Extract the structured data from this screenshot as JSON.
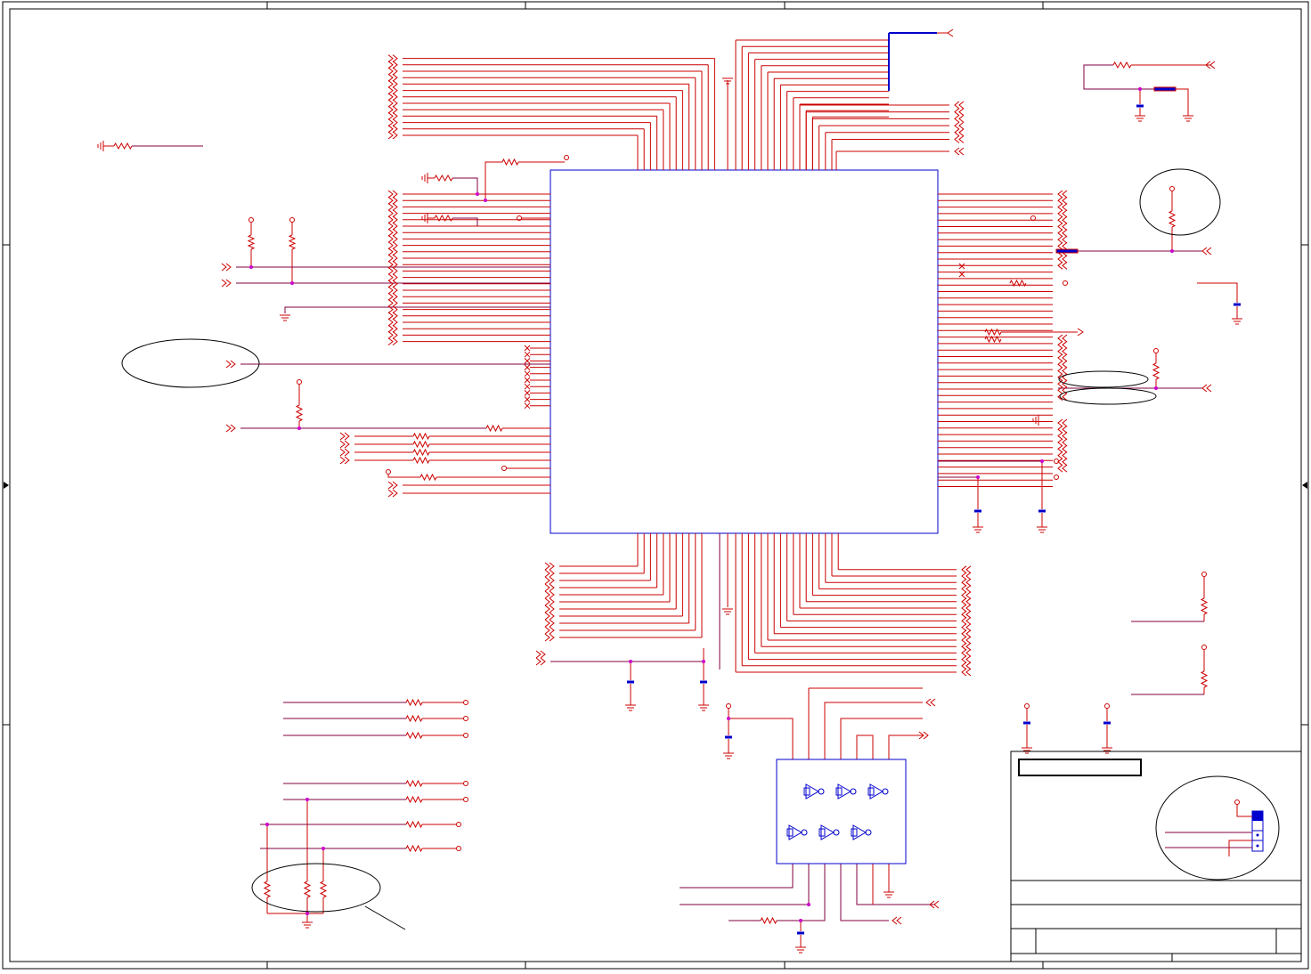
{
  "document": {
    "type": "schematic",
    "title_block_title": "",
    "sheet_number": "",
    "revision": ""
  },
  "colors": {
    "background": "#ffffff",
    "border": "#000000",
    "wire": "#cc0000",
    "net": "#800040",
    "component": "#0000cc",
    "junction": "#cc00cc",
    "annotation": "#000000"
  },
  "parts": {
    "main_ic": "main-ic",
    "inverter_ic": "hex-inverter",
    "connector": "jumper-header"
  }
}
